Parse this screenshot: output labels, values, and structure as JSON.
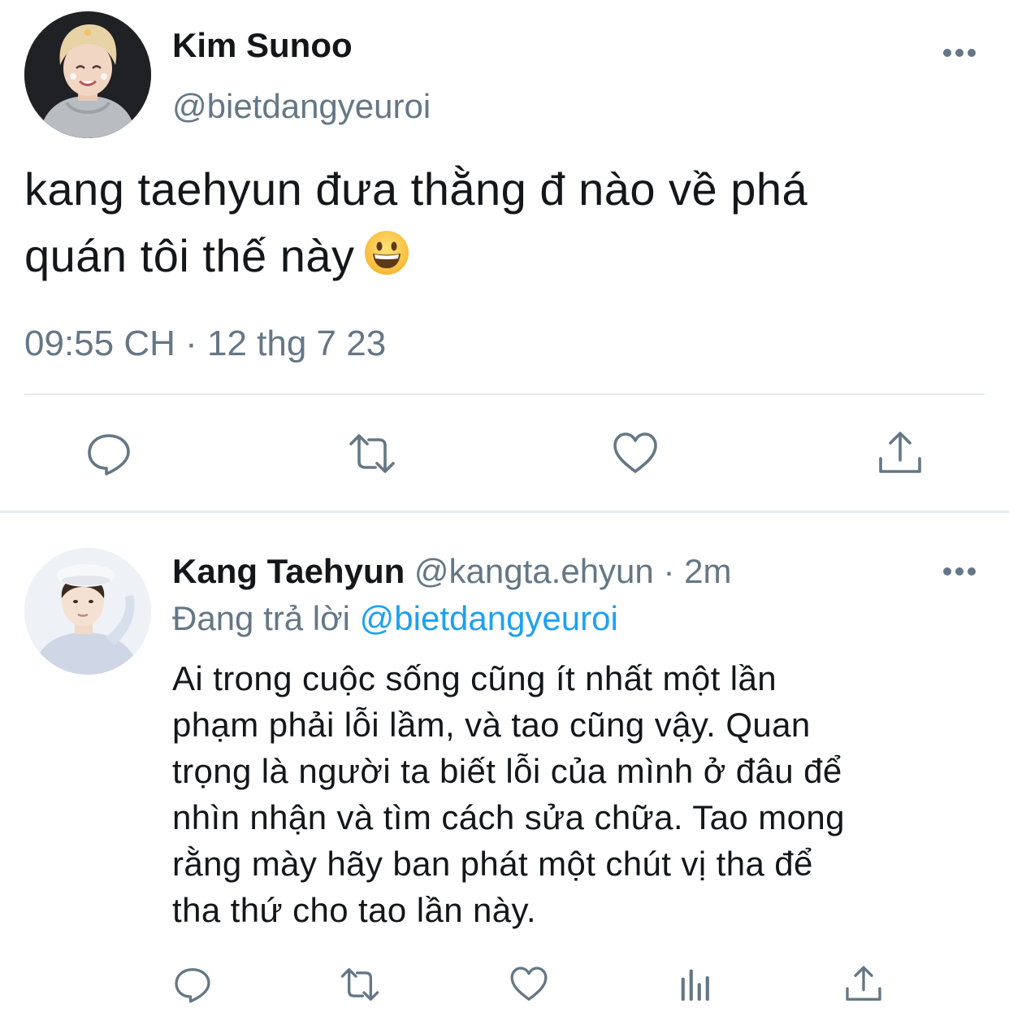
{
  "tweet": {
    "author": {
      "display_name": "Kim Sunoo",
      "handle": "@bietdangyeuroi"
    },
    "text_line1": "kang taehyun đưa thằng đ nào về phá",
    "text_line2": "quán tôi thế này",
    "emoji": "grinning-face",
    "timestamp": "09:55 CH · 12 thg 7 23",
    "actions": [
      "reply-icon",
      "retweet-icon",
      "like-icon",
      "share-icon"
    ]
  },
  "reply": {
    "author": {
      "display_name": "Kang Taehyun",
      "handle": "@kangta.ehyun",
      "separator": "·",
      "time": "2m"
    },
    "replying_prefix": "Đang trả lời",
    "replying_to": "@bietdangyeuroi",
    "text_lines": [
      "Ai trong cuộc sống cũng ít nhất một lần",
      "phạm phải lỗi lầm, và tao cũng vậy. Quan",
      "trọng là người ta biết lỗi của mình ở đâu để",
      "nhìn nhận và tìm cách sửa chữa. Tao mong",
      "rằng mày hãy ban phát một chút vị tha để",
      "tha thứ cho tao lần này."
    ],
    "actions": [
      "reply-icon",
      "retweet-icon",
      "like-icon",
      "analytics-icon",
      "share-icon"
    ]
  },
  "colors": {
    "text": "#14171a",
    "secondary": "#657786",
    "link": "#1da1f2",
    "divider": "#e6ecf0"
  }
}
